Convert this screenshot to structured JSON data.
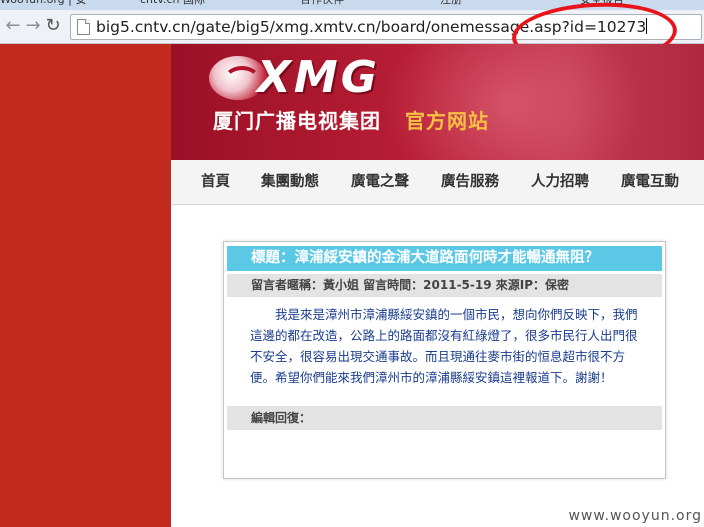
{
  "browser": {
    "tabs": [
      {
        "label": "WooYun.org | 安"
      },
      {
        "label": "cntv.cn 国际"
      },
      {
        "label": "合作伙伴"
      },
      {
        "label": "注册"
      },
      {
        "label": "安全报告"
      }
    ],
    "back_icon": "back-arrow-icon",
    "forward_icon": "forward-arrow-icon",
    "reload_icon": "reload-icon",
    "url": "big5.cntv.cn/gate/big5/xmg.xmtv.cn/board/onemessage.asp?id=10273",
    "annotation_color": "#e8141a"
  },
  "site": {
    "logo_text": "XMG",
    "group_name": "厦门广播电视集团",
    "site_tag": "官方网站",
    "nav": [
      "首頁",
      "集團動態",
      "廣電之聲",
      "廣告服務",
      "人力招聘",
      "廣電互動"
    ]
  },
  "message": {
    "title": "標題：漳浦綏安鎮的金浦大道路面何時才能暢通無阻？",
    "meta": "留言者暱稱：黃小姐 留言時間：2011-5-19 來源IP：保密",
    "body": "我是來是漳州市漳浦縣綏安鎮的一個市民，想向你們反映下，我們這邊的都在改造，公路上的路面都沒有紅綠燈了，很多市民行人出門很不安全，很容易出現交通事故。而且現通往麥市街的恒息超市很不方便。希望你們能來我們漳州市的漳浦縣綏安鎮這裡報道下。謝謝！",
    "reply_label": "編輯回復："
  },
  "watermark": "www.wooyun.org",
  "colors": {
    "left_bar": "#c22a20",
    "title_bar": "#5bc8e6",
    "body_text": "#1a3d8f",
    "site_tag": "#f6c142"
  }
}
